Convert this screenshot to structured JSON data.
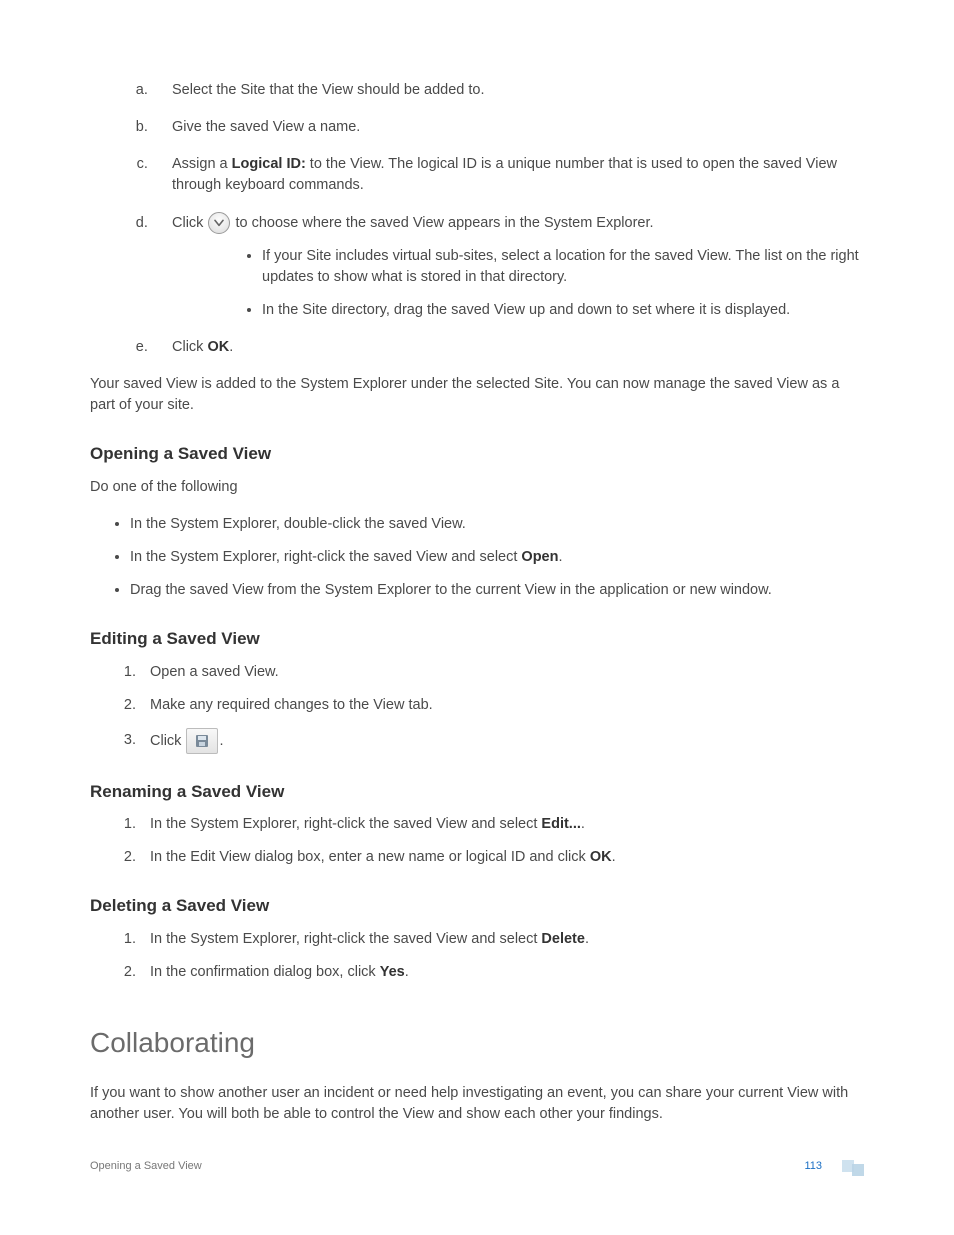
{
  "steps": {
    "a": "Select the Site that the View should be added to.",
    "b": "Give the saved View a name.",
    "c_pre": "Assign a ",
    "c_bold": "Logical ID:",
    "c_post": " to the View. The logical ID is a unique number that is used to open the saved View through keyboard commands.",
    "d_pre": "Click ",
    "d_post": " to choose where the saved View appears in the System Explorer.",
    "d_sub1": "If your Site includes virtual sub-sites, select a location for the saved View. The list on the right updates to show what is stored in that directory.",
    "d_sub2": "In the Site directory, drag the saved View up and down to set where it is displayed.",
    "e_pre": "Click ",
    "e_bold": "OK",
    "e_post": "."
  },
  "after_steps": "Your saved View is added to the System Explorer under the selected Site. You can now manage the saved View as a part of your site.",
  "opening": {
    "heading": "Opening a Saved View",
    "intro": "Do one of the following",
    "b1": "In the System Explorer, double-click the saved View.",
    "b2_pre": "In the System Explorer, right-click the saved View and select ",
    "b2_bold": "Open",
    "b2_post": ".",
    "b3": "Drag the saved View from the System Explorer to the current View in the application or new window."
  },
  "editing": {
    "heading": "Editing a Saved View",
    "s1": "Open a saved View.",
    "s2": "Make any required changes to the View tab.",
    "s3_pre": "Click ",
    "s3_post": "."
  },
  "renaming": {
    "heading": "Renaming a Saved View",
    "s1_pre": "In the System Explorer, right-click the saved View and select ",
    "s1_bold": "Edit...",
    "s1_post": ".",
    "s2_pre": "In the Edit View dialog box, enter a new name or logical ID and click ",
    "s2_bold": "OK",
    "s2_post": "."
  },
  "deleting": {
    "heading": "Deleting a Saved View",
    "s1_pre": "In the System Explorer, right-click the saved View and select ",
    "s1_bold": "Delete",
    "s1_post": ".",
    "s2_pre": "In the confirmation dialog box, click ",
    "s2_bold": "Yes",
    "s2_post": "."
  },
  "collab": {
    "heading": "Collaborating",
    "body": "If you want to show another user an incident or need help investigating an event, you can share your current View with another user. You will both be able to control the View and show each other your findings."
  },
  "footer": {
    "left": "Opening a Saved View",
    "page": "113"
  }
}
